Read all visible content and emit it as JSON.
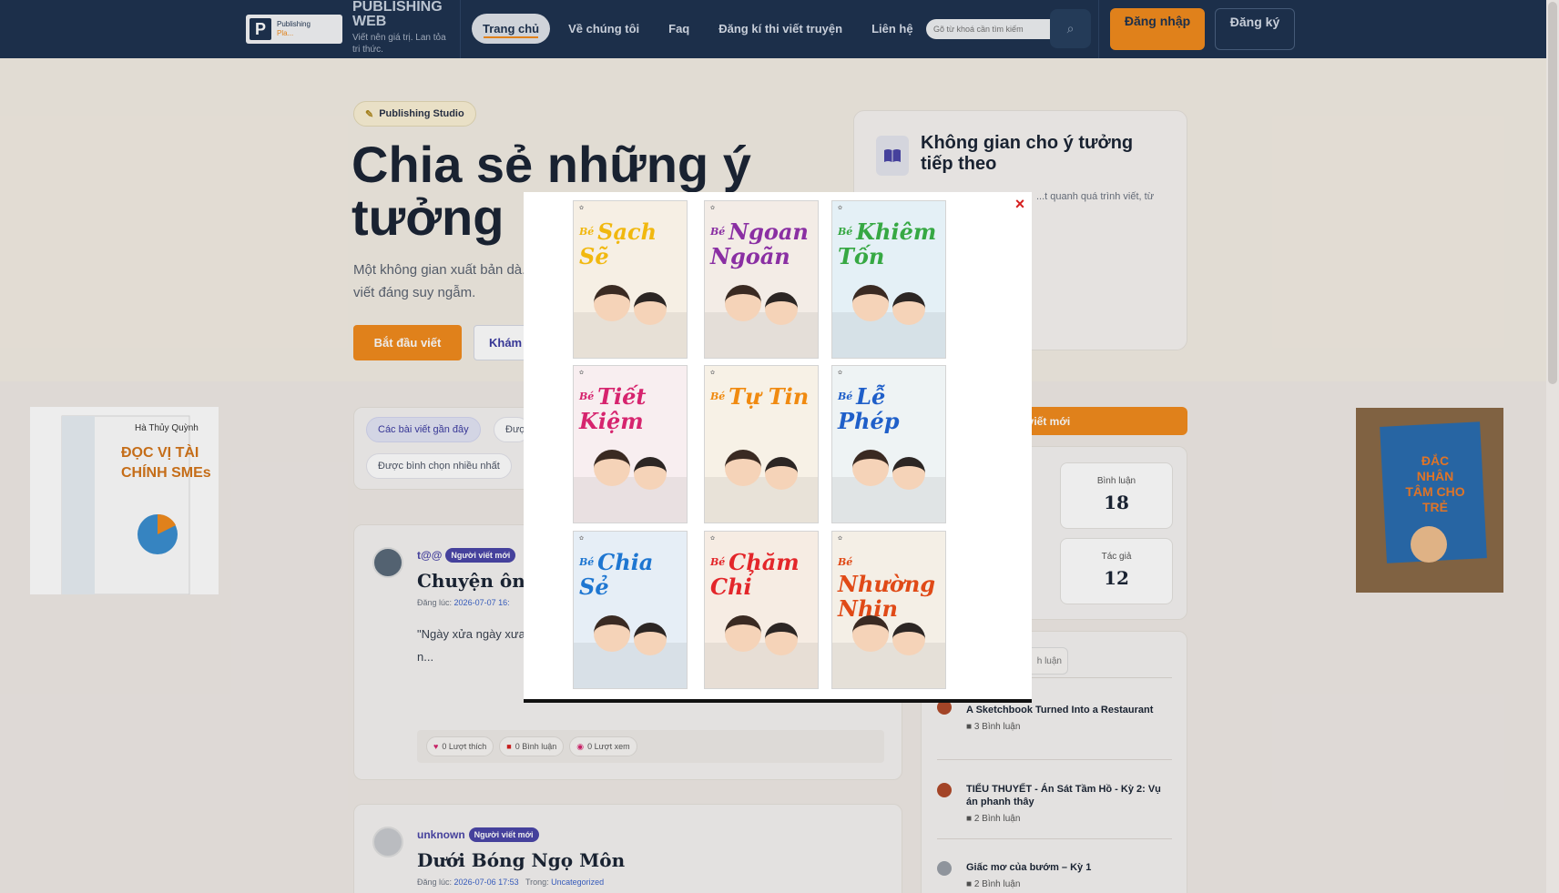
{
  "header": {
    "logo_text": "Publishing",
    "logo_sub": "Pla...",
    "brand_name": "PUBLISHING WEB",
    "brand_tagline": "Viết nên giá trị. Lan tỏa tri thức.",
    "nav": [
      "Trang chủ",
      "Về chúng tôi",
      "Faq",
      "Đăng kí thi viết truyện",
      "Liên hệ"
    ],
    "search_placeholder": "Gõ từ khoá cần tìm kiếm",
    "login": "Đăng nhập",
    "register": "Đăng ký"
  },
  "hero": {
    "pill": "Publishing Studio",
    "title": "Chia sẻ những ý tưởng",
    "desc": "Một không gian xuất bản dà... viết đáng suy ngẫm.",
    "btn_start": "Bắt đầu viết",
    "btn_explore": "Khám",
    "card_title": "Không gian cho ý tưởng tiếp theo",
    "card_text": "...t quanh quá trình viết, từ"
  },
  "filters": [
    "Các bài viết gần đây",
    "Đượ",
    "Được bình chọn nhiều nhất"
  ],
  "posts": [
    {
      "author": "t@@",
      "badge": "Người viết mới",
      "title": "Chuyện ông T",
      "meta_label": "Đăng lúc:",
      "meta_date": "2026-07-07 16:",
      "excerpt": "\"Ngày xửa ngày xưa... của ông còn bé tí, ... là ông Tám Râu.Này... đúng một bộ thôi, n...",
      "likes": "0 Lượt thích",
      "comments": "0 Bình luận",
      "views": "0 Lượt xem"
    },
    {
      "author": "unknown",
      "badge": "Người viết mới",
      "title": "Dưới Bóng Ngọ Môn",
      "meta_label": "Đăng lúc:",
      "meta_date": "2026-07-06 17:53",
      "meta_in": "Trong:",
      "meta_cat": "Uncategorized"
    }
  ],
  "sidebar": {
    "orange_bar": "i viết mới",
    "stats": [
      {
        "label": "Bình luận",
        "value": "18"
      },
      {
        "label": "Tác giả",
        "value": "12"
      }
    ],
    "tab_fragment": "h luận",
    "items": [
      {
        "title": "A Sketchbook Turned Into a Restaurant",
        "count": "3 Bình luận"
      },
      {
        "title": "TIỂU THUYẾT - Án Sát Tầm Hồ - Kỳ 2: Vụ án phanh thây",
        "count": "2 Bình luận"
      },
      {
        "title": "Giấc mơ của bướm – Kỳ 1",
        "count": "2 Bình luận"
      }
    ]
  },
  "ads": {
    "left": {
      "author": "Hà Thủy Quỳnh",
      "title": "ĐỌC VỊ TÀI CHÍNH SMEs"
    },
    "right": {
      "title": "ĐẮC NHÂN TÂM CHO TRẺ"
    }
  },
  "modal": {
    "close": "×",
    "book_prefix": "Bé",
    "books": [
      {
        "word": "Sạch Sẽ",
        "color": "#f1b80f",
        "bg": "#f6efe4"
      },
      {
        "word": "Ngoan Ngoãn",
        "color": "#8a2fa3",
        "bg": "#f3ece6"
      },
      {
        "word": "Khiêm Tốn",
        "color": "#36a843",
        "bg": "#e4f0f6"
      },
      {
        "word": "Tiết Kiệm",
        "color": "#d6246e",
        "bg": "#f8eef0"
      },
      {
        "word": "Tự Tin",
        "color": "#f08a10",
        "bg": "#f7f1e6"
      },
      {
        "word": "Lễ Phép",
        "color": "#1f5fc9",
        "bg": "#eef3f4"
      },
      {
        "word": "Chia Sẻ",
        "color": "#1e76d1",
        "bg": "#e6eef6"
      },
      {
        "word": "Chăm Chỉ",
        "color": "#e3262a",
        "bg": "#f6ece3"
      },
      {
        "word": "Nhường Nhịn",
        "color": "#e04a17",
        "bg": "#f4efe6"
      }
    ]
  }
}
